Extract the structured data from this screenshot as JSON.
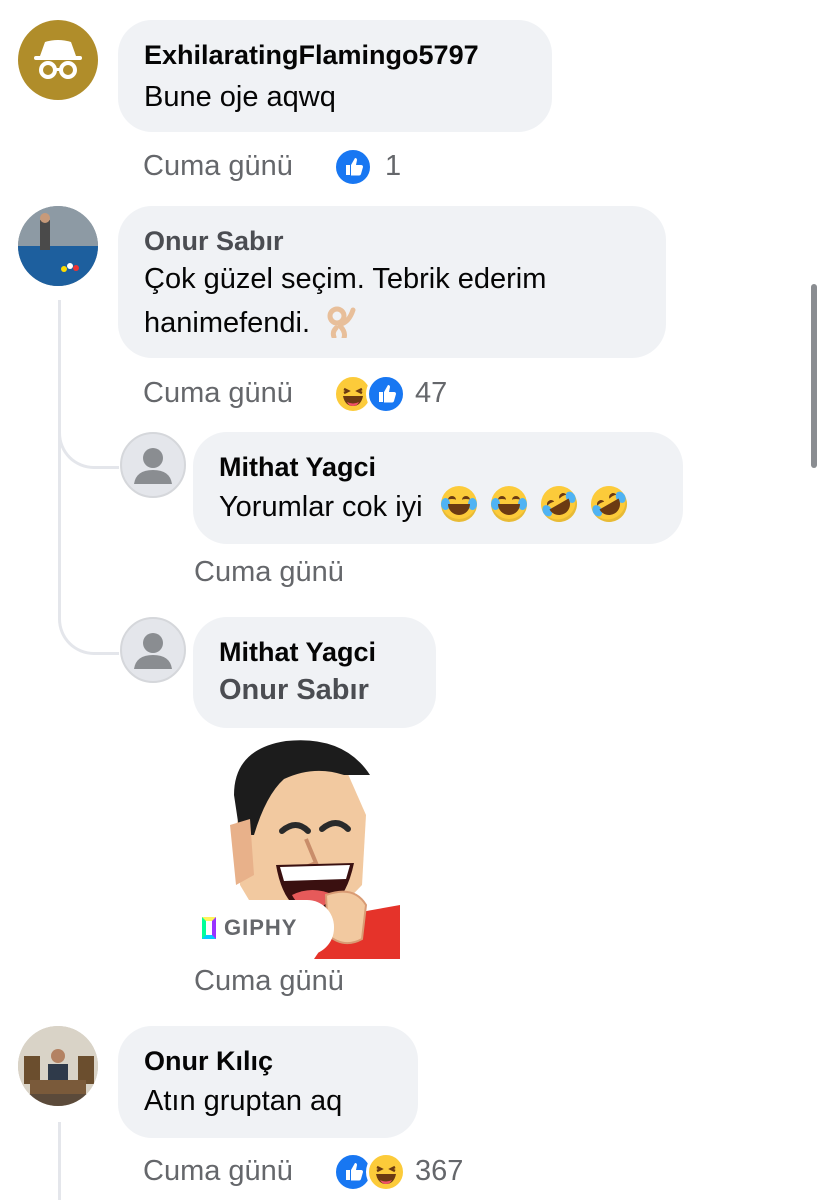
{
  "comments": [
    {
      "author": "ExhilaratingFlamingo5797",
      "text": "Bune oje aqwq",
      "time": "Cuma günü",
      "reaction_count": "1",
      "reactions": [
        "like-icon"
      ],
      "avatar_icon": "incognito-icon"
    },
    {
      "author": "Onur Sabır",
      "text_line1": "Çok güzel seçim. Tebrik ederim",
      "text_line2": "hanimefendi.",
      "time": "Cuma günü",
      "reaction_count": "47",
      "reactions": [
        "haha-icon",
        "like-icon"
      ],
      "avatar_icon": "billiards-photo"
    },
    {
      "author": "Mithat Yagci",
      "text": "Yorumlar cok iyi",
      "time": "Cuma günü",
      "avatar_icon": "default-user-icon"
    },
    {
      "author": "Mithat Yagci",
      "mention": "Onur Sabır",
      "time": "Cuma günü",
      "gif_source": "GIPHY",
      "avatar_icon": "default-user-icon"
    },
    {
      "author": "Onur Kılıç",
      "text": "Atın gruptan aq",
      "time": "Cuma günü",
      "reaction_count": "367",
      "reactions": [
        "like-icon",
        "haha-icon"
      ],
      "avatar_icon": "office-photo"
    }
  ],
  "colors": {
    "bubble": "#f0f2f5",
    "meta_text": "#65676b",
    "like_blue": "#1877f2",
    "incognito_gold": "#b08d2a",
    "thread_line": "#e4e6eb"
  }
}
